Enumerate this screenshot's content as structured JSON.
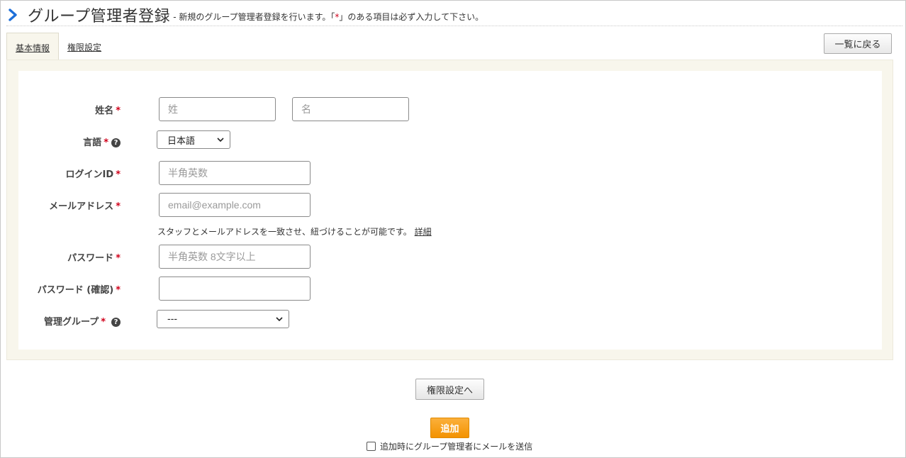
{
  "header": {
    "title": "グループ管理者登録",
    "subtitle_prefix": "- 新規のグループ管理者登録を行います。「",
    "subtitle_star": "*",
    "subtitle_suffix": "」のある項目は必ず入力して下さい。"
  },
  "tabs": [
    {
      "label": "基本情報",
      "active": true
    },
    {
      "label": "権限設定",
      "active": false
    }
  ],
  "back_button": "一覧に戻る",
  "form": {
    "required_mark": "*",
    "name": {
      "label": "姓名",
      "last_placeholder": "姓",
      "first_placeholder": "名"
    },
    "language": {
      "label": "言語",
      "value": "日本語"
    },
    "login_id": {
      "label": "ログインID",
      "placeholder": "半角英数"
    },
    "email": {
      "label": "メールアドレス",
      "placeholder": "email@example.com",
      "note": "スタッフとメールアドレスを一致させ、紐づけることが可能です。",
      "note_link": "詳細"
    },
    "password": {
      "label": "パスワード",
      "placeholder": "半角英数 8文字以上"
    },
    "password_confirm": {
      "label": "パスワード (確認)",
      "placeholder": ""
    },
    "group": {
      "label": "管理グループ",
      "value": "---"
    },
    "help_glyph": "?"
  },
  "buttons": {
    "next": "権限設定へ",
    "add": "追加"
  },
  "send_mail": {
    "label": "追加時にグループ管理者にメールを送信",
    "checked": false
  },
  "colors": {
    "accent": "#1e6fd9",
    "required": "#d0021b",
    "add_button": "#f39200",
    "panel_bg": "#f8f6ec"
  }
}
